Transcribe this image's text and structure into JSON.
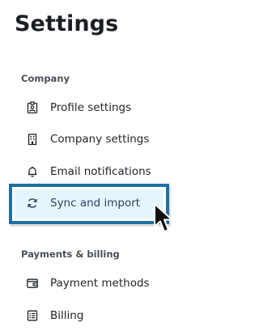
{
  "page": {
    "title": "Settings"
  },
  "sections": [
    {
      "title": "Company",
      "items": [
        {
          "label": "Profile settings",
          "icon": "badge-icon"
        },
        {
          "label": "Company settings",
          "icon": "building-icon"
        },
        {
          "label": "Email notifications",
          "icon": "bell-icon"
        },
        {
          "label": "Sync and import",
          "icon": "sync-icon",
          "active": true
        }
      ]
    },
    {
      "title": "Payments & billing",
      "items": [
        {
          "label": "Payment methods",
          "icon": "wallet-icon"
        },
        {
          "label": "Billing",
          "icon": "invoice-icon"
        }
      ]
    }
  ],
  "colors": {
    "highlight_border": "#1f6fa3",
    "active_background": "#e6f5fb",
    "text": "#1f2328",
    "section_text": "#4a5058"
  }
}
